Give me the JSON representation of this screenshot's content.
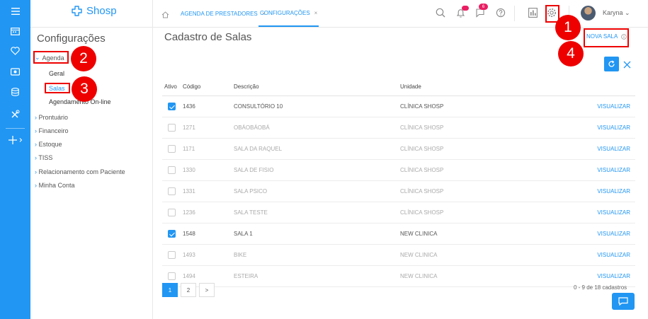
{
  "app": {
    "brand": "Shosp"
  },
  "topbar": {
    "tabs": [
      {
        "label": "AGENDA DE PRESTADORES"
      },
      {
        "label": "CONFIGURAÇÕES"
      }
    ],
    "notification_badge": "",
    "messages_badge": "6",
    "user_name": "Karyna"
  },
  "sidebar": {
    "title": "Configurações",
    "agenda": {
      "label": "Agenda",
      "children": [
        {
          "label": "Geral"
        },
        {
          "label": "Salas"
        },
        {
          "label": "Agendamento On-line"
        }
      ]
    },
    "items": [
      {
        "label": "Prontuário"
      },
      {
        "label": "Financeiro"
      },
      {
        "label": "Estoque"
      },
      {
        "label": "TISS"
      },
      {
        "label": "Relacionamento com Paciente"
      },
      {
        "label": "Minha Conta"
      }
    ]
  },
  "main": {
    "title": "Cadastro de Salas",
    "new_button": "NOVA SALA",
    "columns": {
      "ativo": "Ativo",
      "codigo": "Código",
      "descricao": "Descrição",
      "unidade": "Unidade"
    },
    "action_label": "VISUALIZAR",
    "rows": [
      {
        "active": true,
        "code": "1436",
        "desc": "CONSULTÓRIO 10",
        "unit": "CLÍNICA SHOSP"
      },
      {
        "active": false,
        "code": "1271",
        "desc": "OBÁOBÁOBÁ",
        "unit": "CLÍNICA SHOSP"
      },
      {
        "active": false,
        "code": "1171",
        "desc": "SALA DA RAQUEL",
        "unit": "CLÍNICA SHOSP"
      },
      {
        "active": false,
        "code": "1330",
        "desc": "SALA DE FISIO",
        "unit": "CLÍNICA SHOSP"
      },
      {
        "active": false,
        "code": "1331",
        "desc": "SALA PSICO",
        "unit": "CLÍNICA SHOSP"
      },
      {
        "active": false,
        "code": "1236",
        "desc": "SALA TESTE",
        "unit": "CLÍNICA SHOSP"
      },
      {
        "active": true,
        "code": "1548",
        "desc": "SALA 1",
        "unit": "NEW CLINICA"
      },
      {
        "active": false,
        "code": "1493",
        "desc": "BIKE",
        "unit": "NEW CLINICA"
      },
      {
        "active": false,
        "code": "1494",
        "desc": "ESTEIRA",
        "unit": "NEW CLINICA"
      }
    ],
    "pagination": {
      "pages": [
        "1",
        "2"
      ],
      "next": ">",
      "current": "1"
    },
    "count_text": "0 - 9 de 18 cadastros"
  },
  "annotations": [
    "1",
    "2",
    "3",
    "4"
  ],
  "colors": {
    "primary": "#2196f3",
    "annotation": "#e00000",
    "badge": "#e91e63"
  }
}
